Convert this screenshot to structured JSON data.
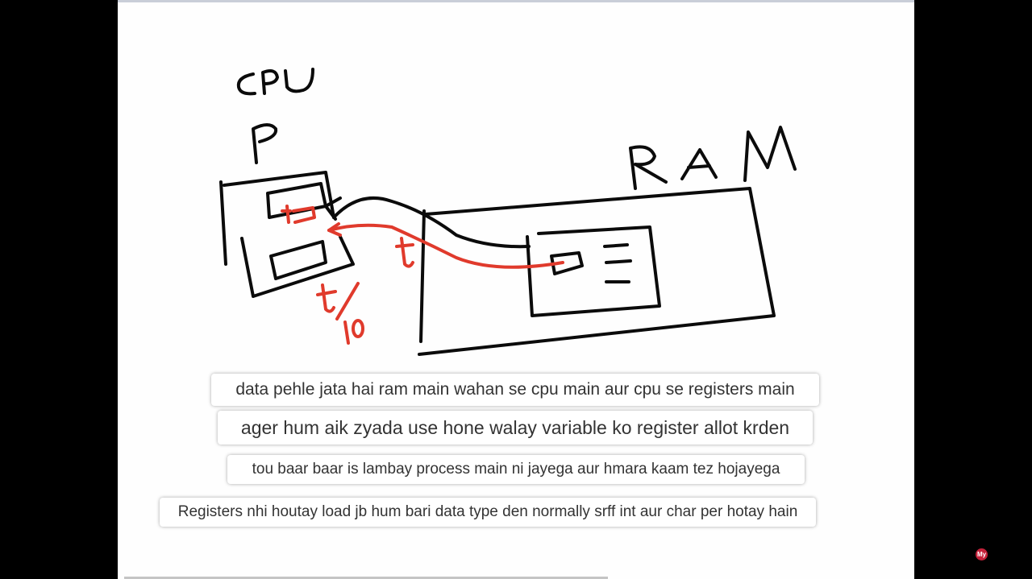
{
  "whiteboard": {
    "labels": {
      "cpu": "CPU",
      "p": "P",
      "ram": "RAM",
      "t_wire": "t",
      "t_cpu": "t",
      "t_divisor": "10"
    },
    "ink": {
      "black": "#0b0b0b",
      "red": "#e03a2c"
    }
  },
  "captions": [
    "data pehle jata hai ram main wahan se cpu main aur cpu se registers main",
    "ager hum aik zyada use hone walay variable ko register allot krden",
    "tou baar baar is lambay process main ni jayega aur hmara kaam tez hojayega",
    "Registers nhi houtay load jb hum bari data type den normally srff int aur char per hotay hain"
  ],
  "watermark": {
    "text": "My"
  }
}
